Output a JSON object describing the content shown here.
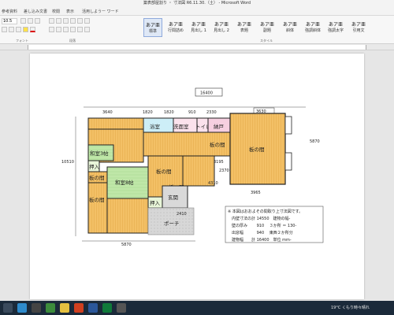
{
  "window": {
    "title": "築表部屋割り ・ 寸法図 R6.11.30.（土） - Microsoft Word"
  },
  "tabs": [
    "参考資料",
    "差し込み文書",
    "校閲",
    "表示",
    "活用しようー ワード"
  ],
  "styles": {
    "items": [
      {
        "big": "あア亜",
        "label": "標準"
      },
      {
        "big": "あア亜",
        "label": "行間詰め"
      },
      {
        "big": "あア亜",
        "label": "見出し 1"
      },
      {
        "big": "あア亜",
        "label": "見出し 2"
      },
      {
        "big": "あア亜",
        "label": "表題"
      },
      {
        "big": "あア亜",
        "label": "副題"
      },
      {
        "big": "あア亜",
        "label": "斜体"
      },
      {
        "big": "あア亜",
        "label": "強調斜体"
      },
      {
        "big": "あア亜",
        "label": "強調太字"
      },
      {
        "big": "あア亜",
        "label": "引用文"
      }
    ],
    "group_label": "スタイル"
  },
  "ribbon_groups": {
    "font": "フォント",
    "paragraph": "段落",
    "font_size": "10.5"
  },
  "floorplan": {
    "dims": {
      "total_width": "16400",
      "top_left": "3640",
      "top_1820": "1820",
      "top_1820b": "1820",
      "top_910": "910",
      "top_2330": "2330",
      "top_3630": "3630",
      "left_height": "10510",
      "right_height": "5870",
      "mid_3195": "3195",
      "mid_2370": "2370",
      "mid_4310": "4310",
      "bottom_3965": "3965",
      "bottom_2410": "2410",
      "bottom_5870": "5870"
    },
    "rooms": {
      "bath": "浴室",
      "washroom": "洗面室",
      "toilet": "トイレ",
      "closet": "納戸",
      "wood1": "板の間",
      "wood_right": "板の間",
      "wood_center": "板の間",
      "wood_mid": "板の間",
      "wood_bl": "板の間",
      "wood_left": "板の間",
      "jp3": "和室3帖",
      "jp8": "和室8帖",
      "oshiire1": "押入",
      "oshiire2": "押入",
      "entrance": "玄関",
      "porch": "ポーチ"
    },
    "notes": [
      "※ 本図はおおよその間取り上寸法図です。",
      "内壁寸法の計 14550　建物の幅-",
      "壁の厚み　　 910　 ３か所 ＝ 130-",
      "出窓幅　　　 940　 東西２か所分",
      "建物幅　　計 16400　単位 mm-"
    ]
  },
  "taskbar": {
    "weather": "19°C くもり時々晴れ"
  }
}
